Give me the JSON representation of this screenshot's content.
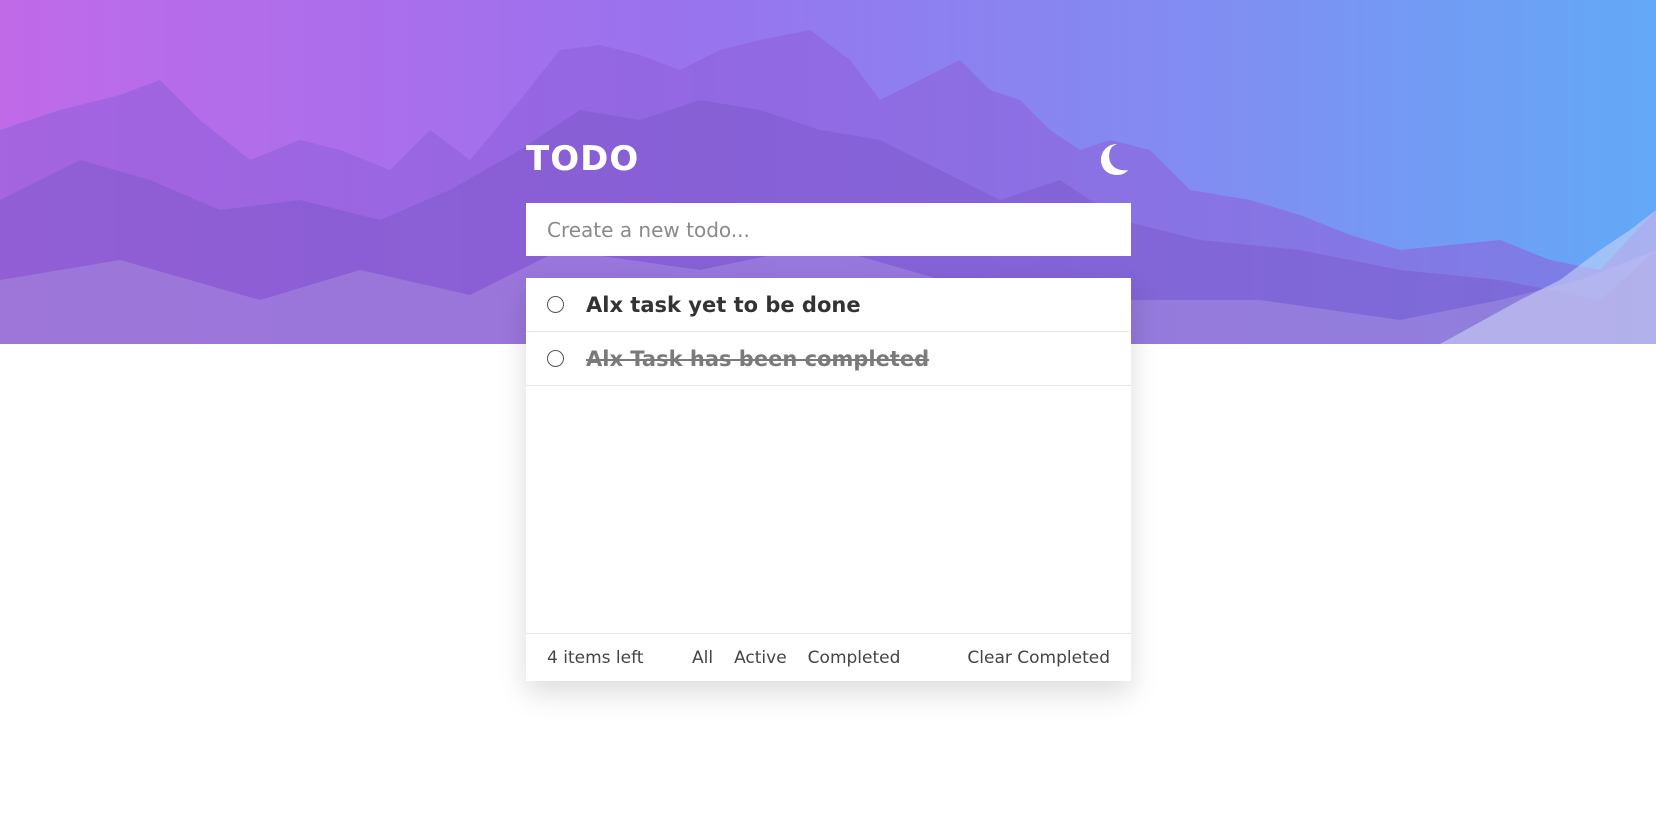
{
  "app": {
    "title": "TODO"
  },
  "icons": {
    "theme_toggle": "moon-icon",
    "checkbox": "circle-outline"
  },
  "colors": {
    "gradient_start": "#b660ec",
    "gradient_end": "#5aa2f6",
    "text": "#333333",
    "completed_text": "#7a7a7a"
  },
  "new_todo": {
    "placeholder": "Create a new todo...",
    "value": ""
  },
  "todos": [
    {
      "text": "Alx task yet to be done",
      "completed": false
    },
    {
      "text": "Alx Task has been completed",
      "completed": true
    }
  ],
  "footer": {
    "items_left": "4 items left",
    "filters": [
      "All",
      "Active",
      "Completed"
    ],
    "clear_label": "Clear Completed"
  }
}
